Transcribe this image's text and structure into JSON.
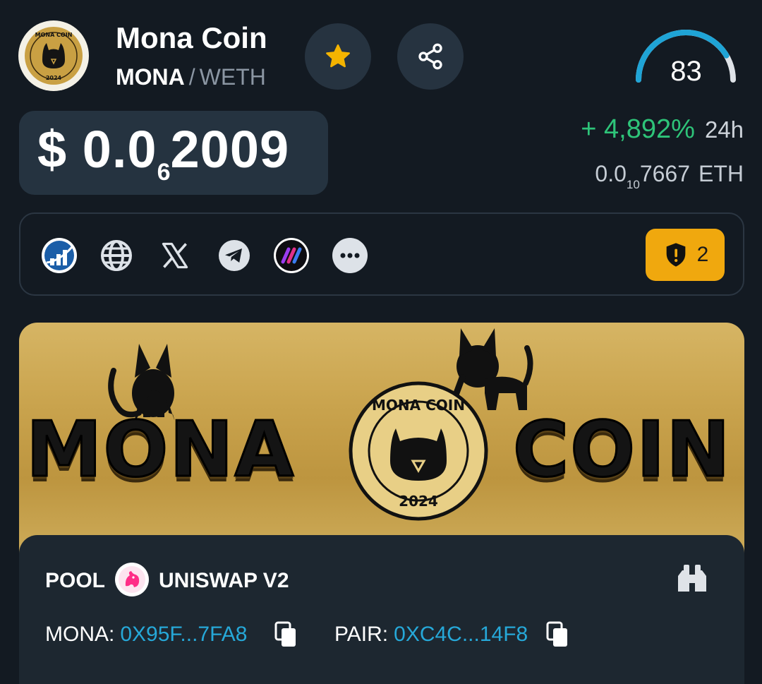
{
  "token": {
    "name": "Mona Coin",
    "symbol": "MONA",
    "pair_separator": "/",
    "quote_symbol": "WETH",
    "logo_icon": "mona-coin-logo",
    "logo_text_top": "MONA COIN",
    "logo_text_bottom": "2024"
  },
  "actions": {
    "favorite_icon": "star-icon",
    "share_icon": "share-icon"
  },
  "score": {
    "value": "83",
    "max": 100,
    "color": "#1fa4d6"
  },
  "price": {
    "prefix": "$ 0.0",
    "zero_count": "6",
    "digits": "2009",
    "change_sign": "+",
    "change_value": "4,892%",
    "change_period": "24h",
    "change_color": "#2ec479",
    "eth_prefix": "0.0",
    "eth_zero_count": "10",
    "eth_digits": "7667",
    "eth_unit": "ETH"
  },
  "links": [
    {
      "icon": "chart-icon"
    },
    {
      "icon": "globe-icon"
    },
    {
      "icon": "x-icon"
    },
    {
      "icon": "telegram-icon"
    },
    {
      "icon": "dapp-icon"
    },
    {
      "icon": "more-icon"
    }
  ],
  "audit": {
    "icon": "shield-alert-icon",
    "count": "2",
    "color": "#f0a80e"
  },
  "banner": {
    "word_left": "MONA",
    "word_right": "COIN",
    "seal_top": "MONA COIN",
    "seal_bottom": "2024"
  },
  "pool": {
    "label": "POOL",
    "dex_icon": "uniswap-icon",
    "dex_name": "UNISWAP V2",
    "explorer_icon": "binoculars-icon",
    "base_label": "MONA:",
    "base_address": "0X95F...7FA8",
    "pair_label": "PAIR:",
    "pair_address": "0XC4C...14F8",
    "copy_icon": "copy-icon",
    "address_color": "#26a8d8"
  }
}
